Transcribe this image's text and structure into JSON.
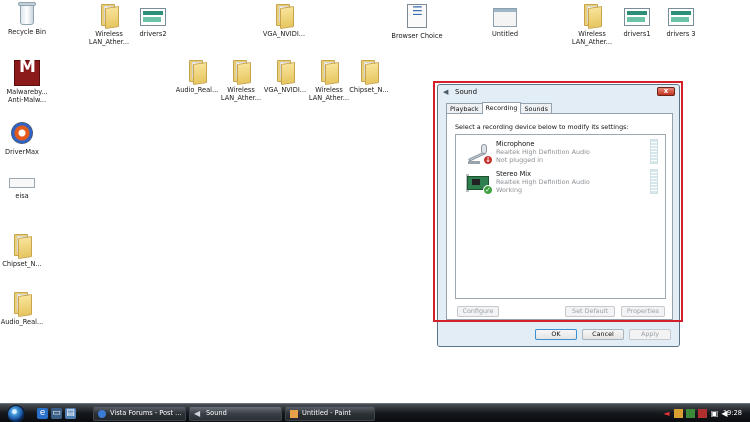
{
  "desktop": {
    "icons": [
      {
        "label": "Recycle Bin"
      },
      {
        "label": "Wireless LAN_Ather..."
      },
      {
        "label": "drivers2"
      },
      {
        "label": "VGA_NVIDI..."
      },
      {
        "label": "Browser Choice"
      },
      {
        "label": "Untitled"
      },
      {
        "label": "Wireless LAN_Ather..."
      },
      {
        "label": "drivers1"
      },
      {
        "label": "drivers 3"
      },
      {
        "label": "Malwareby... Anti-Malw..."
      },
      {
        "label": "Audio_Real..."
      },
      {
        "label": "Wireless LAN_Ather..."
      },
      {
        "label": "VGA_NVIDI..."
      },
      {
        "label": "Wireless LAN_Ather..."
      },
      {
        "label": "Chipset_N..."
      },
      {
        "label": "DriverMax"
      },
      {
        "label": "eisa"
      },
      {
        "label": "Chipset_N..."
      },
      {
        "label": "Audio_Real..."
      }
    ]
  },
  "dialog": {
    "title": "Sound",
    "close_label": "x",
    "tabs": [
      {
        "label": "Playback"
      },
      {
        "label": "Recording"
      },
      {
        "label": "Sounds"
      }
    ],
    "instruction": "Select a recording device below to modify its settings:",
    "devices": [
      {
        "name": "Microphone",
        "driver": "Realtek High Definition Audio",
        "status": "Not plugged in",
        "badge": "↓"
      },
      {
        "name": "Stereo Mix",
        "driver": "Realtek High Definition Audio",
        "status": "Working",
        "badge": "✓"
      }
    ],
    "buttons": {
      "configure": "Configure",
      "set_default": "Set Default",
      "properties": "Properties",
      "ok": "OK",
      "cancel": "Cancel",
      "apply": "Apply"
    }
  },
  "taskbar": {
    "tasks": [
      {
        "label": "Vista Forums - Post ..."
      },
      {
        "label": "Sound"
      },
      {
        "label": "Untitled - Paint"
      }
    ],
    "clock": "19:28"
  },
  "colors": {
    "highlight_frame": "#d4202a",
    "dialog_background": "#e3edf5",
    "taskbar": "#15181c"
  }
}
